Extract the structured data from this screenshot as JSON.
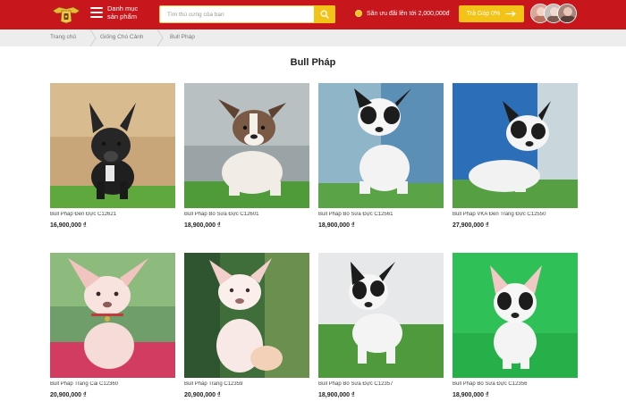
{
  "header": {
    "menu_label": "Danh mục sản phẩm",
    "search_placeholder": "Tìm thú cưng của bạn",
    "promo_text": "Săn ưu đãi lên tới 2,000,000đ",
    "installment_label": "Trả Góp 0%"
  },
  "breadcrumb": [
    "Trang chủ",
    "Giống Chó Cảnh",
    "Bull Pháp"
  ],
  "page_title": "Bull Pháp",
  "products": [
    {
      "name": "Bull Pháp Đen Đực C12621",
      "price": "16,900,000 ₫",
      "icon": "black-french-bulldog"
    },
    {
      "name": "Bull Pháp Bò Sữa Đực C12601",
      "price": "18,900,000 ₫",
      "icon": "brindle-white-french-bulldog"
    },
    {
      "name": "Bull Pháp Bò Sữa Đực C12561",
      "price": "18,900,000 ₫",
      "icon": "piebald-french-bulldog"
    },
    {
      "name": "Bull Pháp VKA Đen Trắng Đực C12550",
      "price": "27,900,000 ₫",
      "icon": "piebald-french-bulldog"
    },
    {
      "name": "Bull Pháp Trắng Cái C12360",
      "price": "20,900,000 ₫",
      "icon": "white-french-bulldog"
    },
    {
      "name": "Bull Pháp Trắng C12359",
      "price": "20,900,000 ₫",
      "icon": "white-french-bulldog"
    },
    {
      "name": "Bull Pháp Bò Sữa Đực C12357",
      "price": "18,900,000 ₫",
      "icon": "piebald-french-bulldog"
    },
    {
      "name": "Bull Pháp Bò Sữa Đực C12356",
      "price": "18,900,000 ₫",
      "icon": "piebald-french-bulldog"
    }
  ],
  "colors": {
    "header_red": "#c8161d",
    "accent_yellow": "#f3c317",
    "breadcrumb_bg": "#ededed"
  }
}
